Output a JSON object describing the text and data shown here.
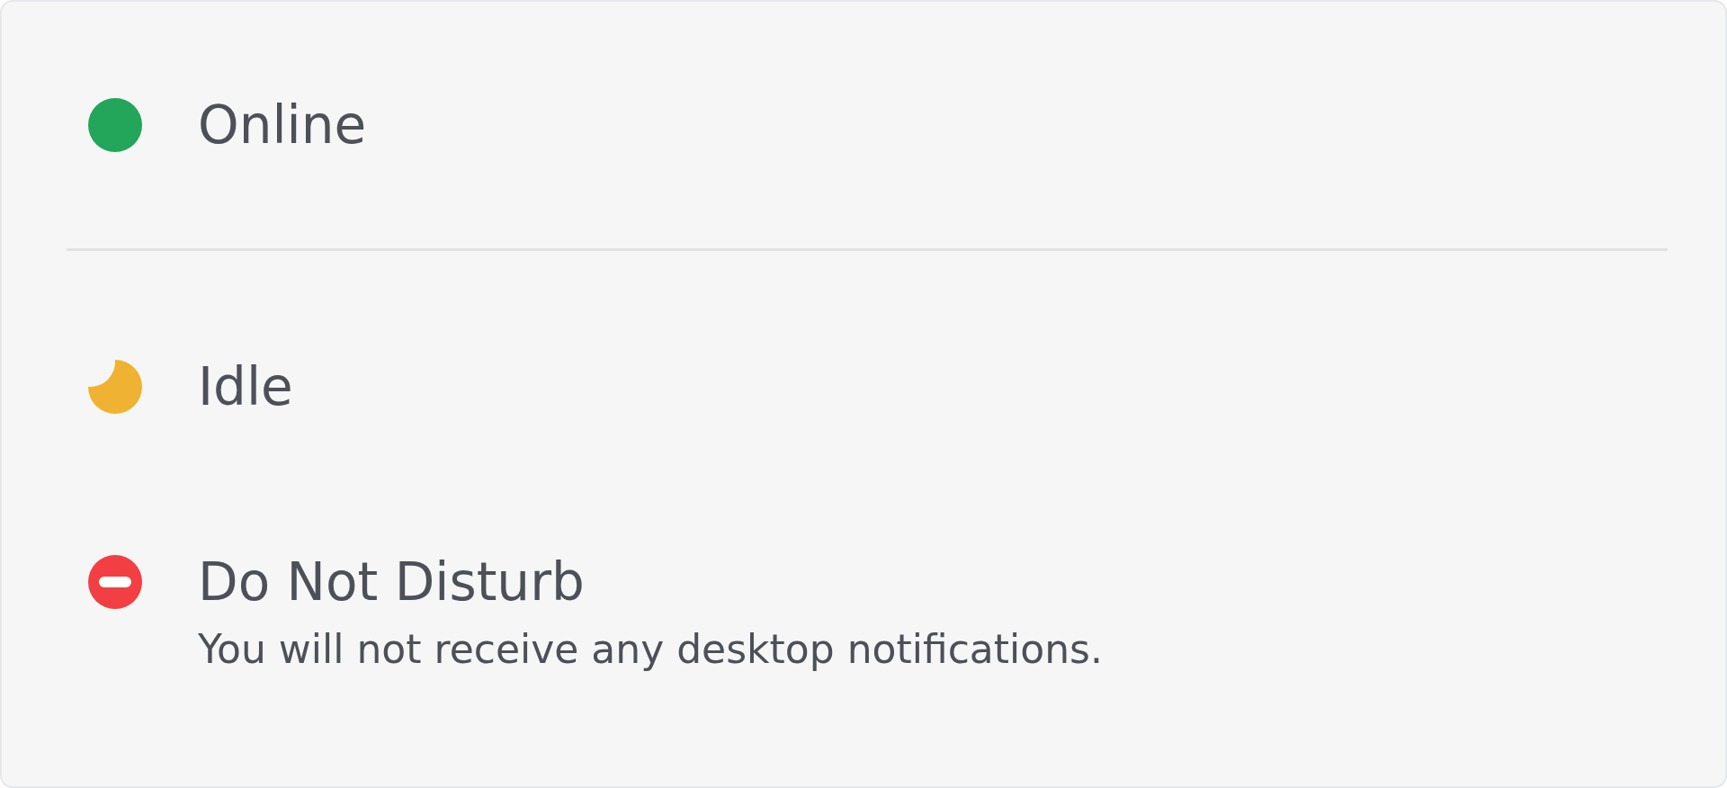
{
  "statuses": [
    {
      "label": "Online",
      "kind": "dot",
      "color": "#23a55a"
    },
    {
      "label": "Idle",
      "kind": "moon",
      "color": "#f0b232"
    },
    {
      "label": "Do Not Disturb",
      "kind": "dnd",
      "color": "#f23f43",
      "description": "You will not receive any desktop notifications."
    }
  ]
}
